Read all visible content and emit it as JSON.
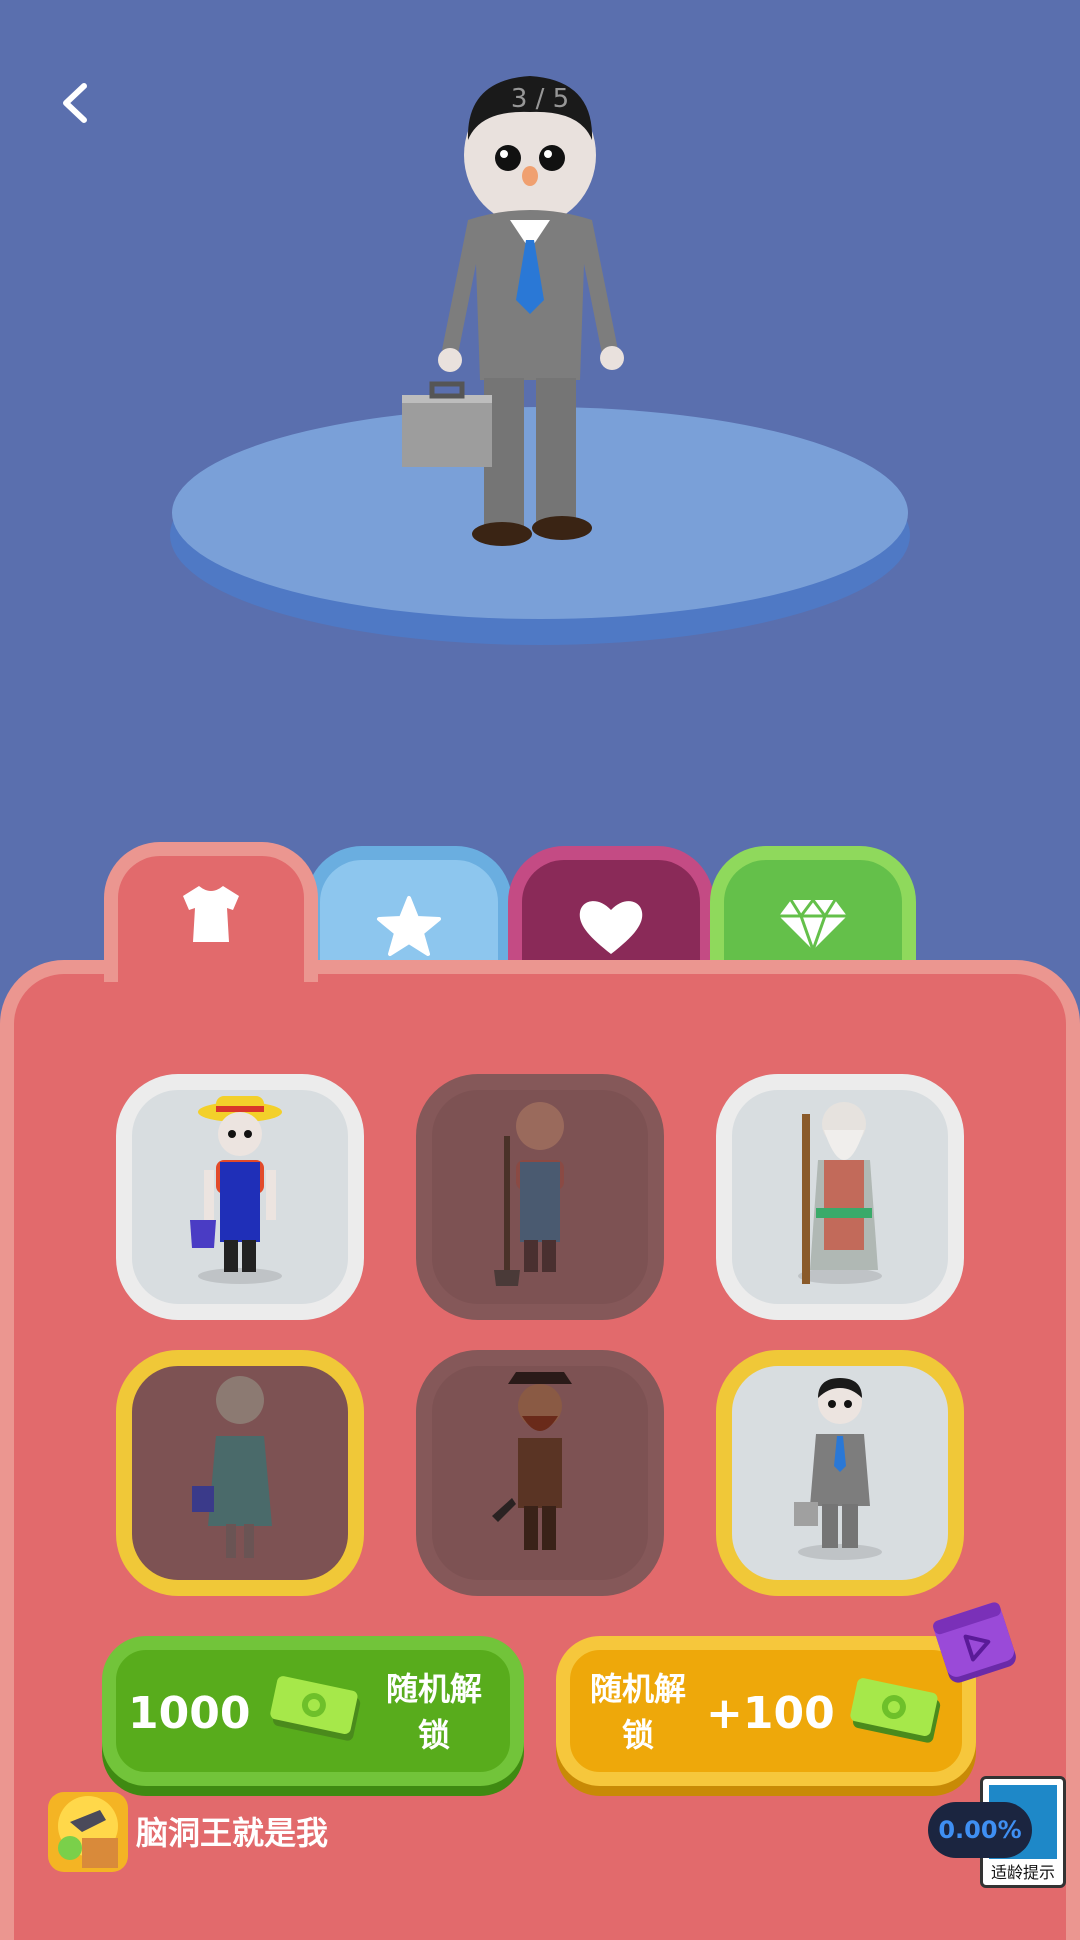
{
  "header": {
    "counter": "3 / 5"
  },
  "tabs": [
    {
      "name": "clothes",
      "icon": "shirt-icon",
      "active": true
    },
    {
      "name": "star",
      "icon": "star-icon"
    },
    {
      "name": "heart",
      "icon": "heart-icon"
    },
    {
      "name": "gem",
      "icon": "diamond-icon"
    }
  ],
  "skins": [
    {
      "id": "farmer",
      "state": "unlocked"
    },
    {
      "id": "farmer-girl",
      "state": "locked"
    },
    {
      "id": "old-wizard",
      "state": "unlocked"
    },
    {
      "id": "woman-dress",
      "state": "locked-gold"
    },
    {
      "id": "pirate",
      "state": "locked"
    },
    {
      "id": "businessman",
      "state": "selected-gold"
    }
  ],
  "buttons": {
    "buy": {
      "amount": "1000",
      "label": "随机解锁"
    },
    "ad": {
      "label": "随机解锁",
      "reward": "+100"
    }
  },
  "ad_banner": {
    "app_name": "脑洞王就是我",
    "percent": "0.00%",
    "age_label": "适龄提示"
  },
  "colors": {
    "background": "#5a6fae",
    "panel": "#e26a6c",
    "green_button": "#58ac1c",
    "yellow_button": "#eea80a"
  }
}
